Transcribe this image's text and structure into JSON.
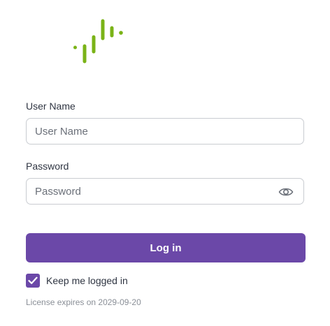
{
  "brand": {
    "logo_icon": "signal-bars-logo",
    "accent_color": "#7ab317",
    "primary_color": "#6b48a8"
  },
  "form": {
    "username": {
      "label": "User Name",
      "placeholder": "User Name",
      "value": ""
    },
    "password": {
      "label": "Password",
      "placeholder": "Password",
      "value": "",
      "toggle_icon": "eye-icon"
    },
    "login_label": "Log in",
    "keep_logged_in": {
      "label": "Keep me logged in",
      "checked": true
    }
  },
  "license_text": "License expires on 2029-09-20"
}
